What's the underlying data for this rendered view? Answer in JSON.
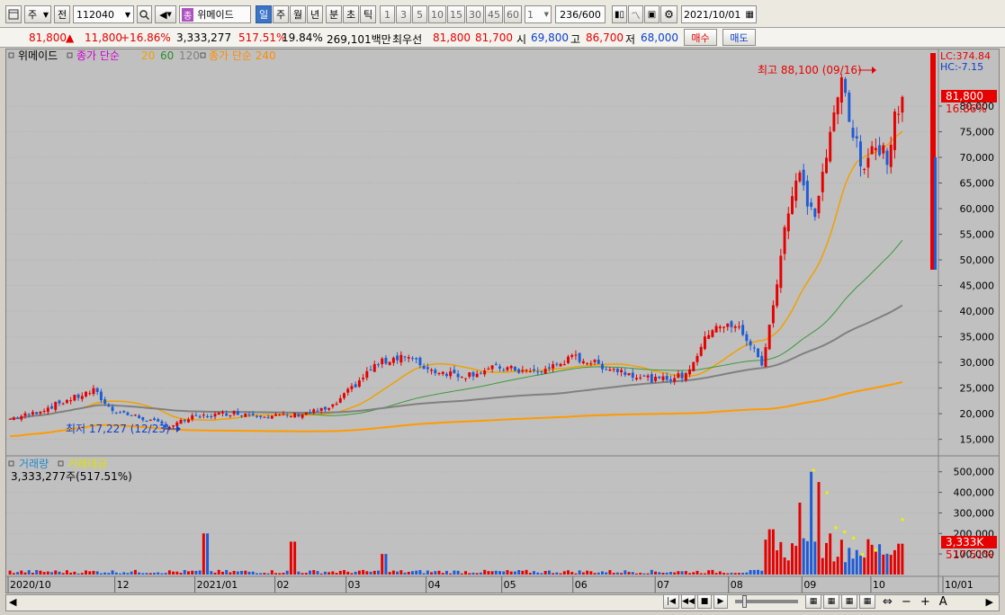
{
  "toolbar": {
    "market": "주",
    "period_prefix": "전",
    "code": "112040",
    "stock_name_prefix": "종",
    "stock_name": "위메이드",
    "intervals": [
      "일",
      "주",
      "월",
      "년",
      "분",
      "초",
      "틱"
    ],
    "active_interval": "일",
    "numbers": [
      "1",
      "3",
      "5",
      "10",
      "15",
      "30",
      "45",
      "60"
    ],
    "step_value": "1",
    "count": "236",
    "count_max": "/600",
    "date": "2021/10/01"
  },
  "quote": {
    "price": "81,800",
    "change_arrow": "▲",
    "change": "11,800",
    "change_pct": "+16.86%",
    "volume": "3,333,277",
    "volume_ratio": "517.51%",
    "turnover": "19.84%",
    "amount": "269,101백만",
    "best_label": "최우선",
    "ask": "81,800",
    "bid": "81,700",
    "open_label": "시",
    "open": "69,800",
    "high_label": "고",
    "high": "86,700",
    "low_label": "저",
    "low": "68,000",
    "buy_label": "매수",
    "sell_label": "매도"
  },
  "legend": {
    "name": "위메이드",
    "ma_label": "종가 단순",
    "ma20": "20",
    "ma60": "60",
    "ma120": "120",
    "ma240_label": "종가 단순 240"
  },
  "annotations": {
    "high": "최고 88,100 (09/16)",
    "low": "최저 17,227 (12/23)",
    "lc": "LC:374.84",
    "hc": "HC:-7.15",
    "price_tag": "81,800",
    "pct_tag": "16.86%"
  },
  "volume_panel": {
    "label1": "거래량",
    "label2": "거래대금",
    "value": "3,333,277주(517.51%)",
    "tag_value": "3,333K",
    "tag_pct": "517.51%"
  },
  "colors": {
    "up": "#e60000",
    "down": "#1e5bd6",
    "ma20": "#f0a000",
    "ma60": "#3a9a3a",
    "ma120": "#808080",
    "ma240": "#ff9a00",
    "amount": "#f0f000"
  },
  "chart_data": {
    "type": "candlestick",
    "y_ticks": [
      15000,
      20000,
      25000,
      30000,
      35000,
      40000,
      45000,
      50000,
      55000,
      60000,
      65000,
      70000,
      75000,
      80000
    ],
    "y_tick_labels": [
      "15,000",
      "20,000",
      "25,000",
      "30,000",
      "35,000",
      "40,000",
      "45,000",
      "50,000",
      "55,000",
      "60,000",
      "65,000",
      "70,000",
      "75,000",
      "80,000"
    ],
    "ylim": [
      13000,
      90000
    ],
    "vol_ticks": [
      100000,
      200000,
      300000,
      400000,
      500000
    ],
    "vol_tick_labels": [
      "100,000",
      "200,000",
      "300,000",
      "400,000",
      "500,000"
    ],
    "vol_max": 560000,
    "x_labels": [
      "2020/10",
      "12",
      "2021/01",
      "02",
      "03",
      "04",
      "05",
      "06",
      "07",
      "08",
      "09",
      "10",
      "10/01"
    ],
    "x_label_pos": [
      0,
      48,
      84,
      120,
      152,
      188,
      222,
      254,
      291,
      324,
      357,
      388,
      403
    ],
    "n_days": 236,
    "close_anchors": [
      [
        0,
        19000
      ],
      [
        10,
        20000
      ],
      [
        25,
        22500
      ],
      [
        38,
        24500
      ],
      [
        45,
        21000
      ],
      [
        60,
        19000
      ],
      [
        72,
        17500
      ],
      [
        82,
        19200
      ],
      [
        100,
        20200
      ],
      [
        125,
        19500
      ],
      [
        145,
        21000
      ],
      [
        165,
        29500
      ],
      [
        177,
        31500
      ],
      [
        190,
        28500
      ],
      [
        205,
        27500
      ],
      [
        220,
        29000
      ],
      [
        238,
        28000
      ],
      [
        255,
        31000
      ],
      [
        270,
        29000
      ],
      [
        292,
        26500
      ],
      [
        305,
        27500
      ],
      [
        318,
        37500
      ],
      [
        330,
        36500
      ],
      [
        340,
        29500
      ],
      [
        345,
        42000
      ],
      [
        350,
        57000
      ],
      [
        356,
        67000
      ],
      [
        363,
        58000
      ],
      [
        370,
        73000
      ],
      [
        376,
        86000
      ],
      [
        380,
        76000
      ],
      [
        386,
        66000
      ],
      [
        390,
        74000
      ],
      [
        396,
        70000
      ],
      [
        402,
        81800
      ]
    ],
    "volume_spikes": [
      [
        88,
        200000
      ],
      [
        128,
        160000
      ],
      [
        169,
        100000
      ],
      [
        344,
        220000
      ],
      [
        357,
        350000
      ],
      [
        362,
        500000
      ],
      [
        365,
        450000
      ],
      [
        370,
        200000
      ],
      [
        402,
        150000
      ]
    ],
    "amount_points": [
      [
        362,
        510000
      ],
      [
        368,
        400000
      ],
      [
        372,
        230000
      ],
      [
        376,
        210000
      ],
      [
        380,
        180000
      ],
      [
        384,
        100000
      ],
      [
        390,
        120000
      ],
      [
        402,
        270000
      ]
    ],
    "last_close": 81800,
    "high": {
      "value": 88100,
      "date": "09/16"
    },
    "low": {
      "value": 17227,
      "date": "12/23"
    }
  }
}
